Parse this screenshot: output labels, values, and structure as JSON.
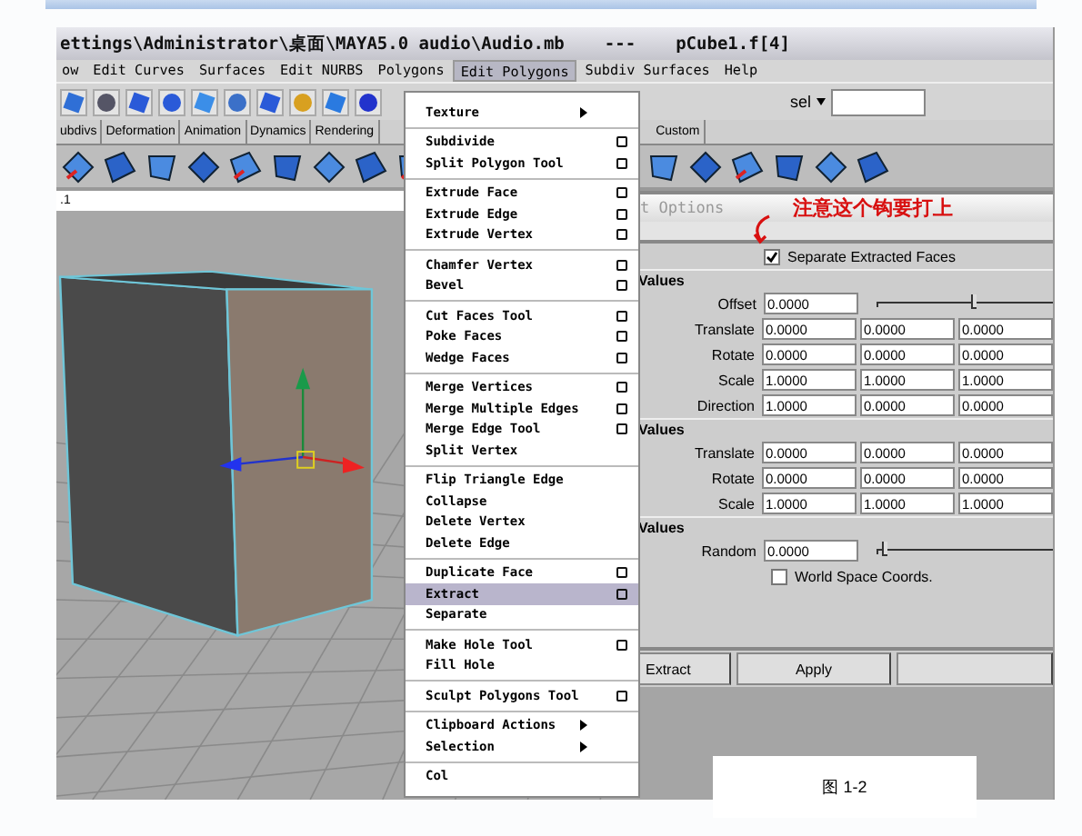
{
  "window": {
    "title_path": "ettings\\Administrator\\桌面\\MAYA5.0 audio\\Audio.mb",
    "title_separator": "---",
    "title_object": "pCube1.f[4]"
  },
  "menubar": [
    {
      "label": "ow",
      "selected": false
    },
    {
      "label": "Edit Curves",
      "selected": false
    },
    {
      "label": "Surfaces",
      "selected": false
    },
    {
      "label": "Edit NURBS",
      "selected": false
    },
    {
      "label": "Polygons",
      "selected": false
    },
    {
      "label": "Edit Polygons",
      "selected": true
    },
    {
      "label": "Subdiv Surfaces",
      "selected": false
    },
    {
      "label": "Help",
      "selected": false
    }
  ],
  "toolbar": {
    "selection_mask": "sel"
  },
  "shelf_tabs": [
    "ubdivs",
    "Deformation",
    "Animation",
    "Dynamics",
    "Rendering",
    "Custom"
  ],
  "viewport": {
    "label": ".1"
  },
  "menu": {
    "groups": [
      [
        {
          "label": "Texture",
          "option": false,
          "submenu": true,
          "selected": false
        }
      ],
      [
        {
          "label": "Subdivide",
          "option": true,
          "submenu": false,
          "selected": false
        },
        {
          "label": "Split Polygon Tool",
          "option": true,
          "submenu": false,
          "selected": false
        }
      ],
      [
        {
          "label": "Extrude Face",
          "option": true,
          "submenu": false,
          "selected": false
        },
        {
          "label": "Extrude Edge",
          "option": true,
          "submenu": false,
          "selected": false
        },
        {
          "label": "Extrude Vertex",
          "option": true,
          "submenu": false,
          "selected": false
        }
      ],
      [
        {
          "label": "Chamfer Vertex",
          "option": true,
          "submenu": false,
          "selected": false
        },
        {
          "label": "Bevel",
          "option": true,
          "submenu": false,
          "selected": false
        }
      ],
      [
        {
          "label": "Cut Faces Tool",
          "option": true,
          "submenu": false,
          "selected": false
        },
        {
          "label": "Poke Faces",
          "option": true,
          "submenu": false,
          "selected": false
        },
        {
          "label": "Wedge Faces",
          "option": true,
          "submenu": false,
          "selected": false
        }
      ],
      [
        {
          "label": "Merge Vertices",
          "option": true,
          "submenu": false,
          "selected": false
        },
        {
          "label": "Merge Multiple Edges",
          "option": true,
          "submenu": false,
          "selected": false
        },
        {
          "label": "Merge Edge Tool",
          "option": true,
          "submenu": false,
          "selected": false
        },
        {
          "label": "Split Vertex",
          "option": false,
          "submenu": false,
          "selected": false
        }
      ],
      [
        {
          "label": "Flip Triangle Edge",
          "option": false,
          "submenu": false,
          "selected": false
        },
        {
          "label": "Collapse",
          "option": false,
          "submenu": false,
          "selected": false
        },
        {
          "label": "Delete Vertex",
          "option": false,
          "submenu": false,
          "selected": false
        },
        {
          "label": "Delete Edge",
          "option": false,
          "submenu": false,
          "selected": false
        }
      ],
      [
        {
          "label": "Duplicate Face",
          "option": true,
          "submenu": false,
          "selected": false
        },
        {
          "label": "Extract",
          "option": true,
          "submenu": false,
          "selected": true
        },
        {
          "label": "Separate",
          "option": false,
          "submenu": false,
          "selected": false
        }
      ],
      [
        {
          "label": "Make Hole Tool",
          "option": true,
          "submenu": false,
          "selected": false
        },
        {
          "label": "Fill Hole",
          "option": false,
          "submenu": false,
          "selected": false
        }
      ],
      [
        {
          "label": "Sculpt Polygons Tool",
          "option": true,
          "submenu": false,
          "selected": false
        }
      ],
      [
        {
          "label": "Clipboard Actions",
          "option": false,
          "submenu": true,
          "selected": false
        },
        {
          "label": "Selection",
          "option": false,
          "submenu": true,
          "selected": false
        }
      ],
      [
        {
          "label": "Col",
          "option": false,
          "submenu": false,
          "selected": false
        }
      ]
    ]
  },
  "options": {
    "title": "t Options",
    "annotation": "注意这个钩要打上",
    "separate": {
      "label": "Separate Extracted Faces",
      "checked": true
    },
    "sections": [
      {
        "header": "Values",
        "rows": [
          {
            "kind": "slider",
            "label": "Offset",
            "values": [
              "0.0000"
            ],
            "level": 0.55
          },
          {
            "kind": "vector",
            "label": "Translate",
            "values": [
              "0.0000",
              "0.0000",
              "0.0000"
            ]
          },
          {
            "kind": "vector",
            "label": "Rotate",
            "values": [
              "0.0000",
              "0.0000",
              "0.0000"
            ]
          },
          {
            "kind": "vector",
            "label": "Scale",
            "values": [
              "1.0000",
              "1.0000",
              "1.0000"
            ]
          },
          {
            "kind": "vector",
            "label": "Direction",
            "values": [
              "1.0000",
              "0.0000",
              "0.0000"
            ]
          }
        ]
      },
      {
        "header": "Values",
        "rows": [
          {
            "kind": "vector",
            "label": "Translate",
            "values": [
              "0.0000",
              "0.0000",
              "0.0000"
            ]
          },
          {
            "kind": "vector",
            "label": "Rotate",
            "values": [
              "0.0000",
              "0.0000",
              "0.0000"
            ]
          },
          {
            "kind": "vector",
            "label": "Scale",
            "values": [
              "1.0000",
              "1.0000",
              "1.0000"
            ]
          }
        ]
      },
      {
        "header": "Values",
        "rows": [
          {
            "kind": "slider",
            "label": "Random",
            "values": [
              "0.0000"
            ],
            "level": 0.02
          },
          {
            "kind": "checkbox",
            "label": "World Space Coords.",
            "checked": false
          }
        ]
      }
    ],
    "buttons": [
      {
        "label": "Extract"
      },
      {
        "label": "Apply"
      }
    ]
  },
  "caption": "图 1-2"
}
